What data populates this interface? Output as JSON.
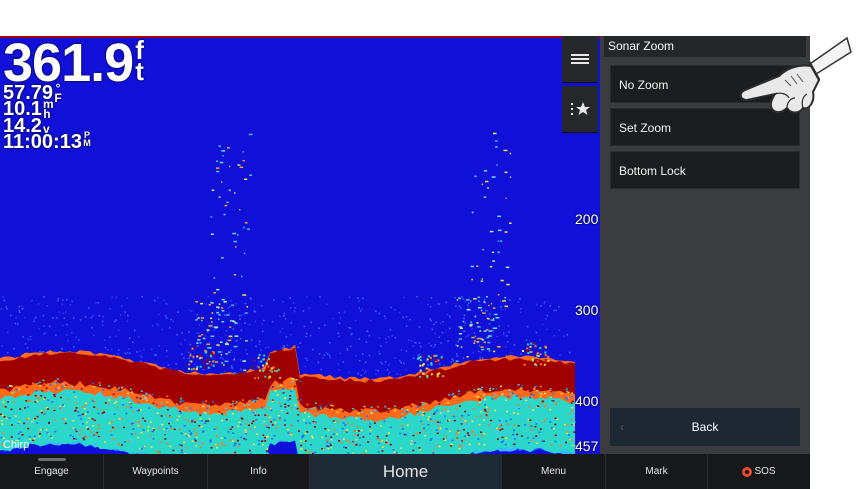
{
  "readouts": {
    "depth": "361.9",
    "depth_unit": "ft",
    "temperature": "57.79",
    "temperature_unit": "°F",
    "speed": "10.1",
    "speed_unit": "mh",
    "voltage": "14.2",
    "voltage_unit": "v",
    "time": "11:00:13",
    "time_unit": "PM"
  },
  "depth_scale": [
    "200",
    "300",
    "400",
    "457"
  ],
  "mode_label": "Chirp",
  "side_buttons": {
    "menu_icon": "hamburger-icon",
    "favorites_icon": "list-star-icon"
  },
  "panel": {
    "title": "Sonar Zoom",
    "items": [
      "No Zoom",
      "Set Zoom",
      "Bottom Lock"
    ],
    "back_label": "Back"
  },
  "bottom_bar": {
    "tabs": [
      "Engage",
      "Waypoints",
      "Info",
      "Home",
      "Menu",
      "Mark",
      "SOS"
    ]
  },
  "colors": {
    "water": "#1010d8",
    "bottom": "#a00000",
    "panel": "#3a3c3f",
    "sos": "#e5492e"
  }
}
